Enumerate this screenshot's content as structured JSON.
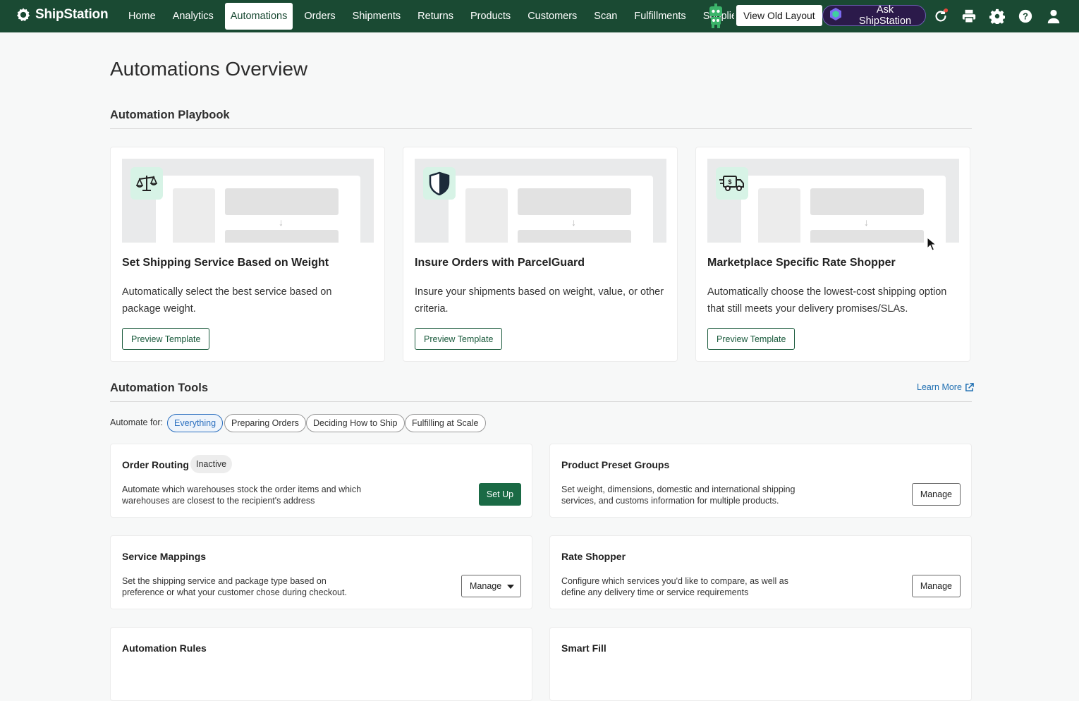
{
  "app": {
    "brand": "ShipStation",
    "accent": "#1a4a33"
  },
  "nav": {
    "items": [
      {
        "label": "Home",
        "active": false
      },
      {
        "label": "Analytics",
        "active": false
      },
      {
        "label": "Automations",
        "active": true
      },
      {
        "label": "Orders",
        "active": false
      },
      {
        "label": "Shipments",
        "active": false
      },
      {
        "label": "Returns",
        "active": false
      },
      {
        "label": "Products",
        "active": false
      },
      {
        "label": "Customers",
        "active": false
      },
      {
        "label": "Scan",
        "active": false
      },
      {
        "label": "Fulfillments",
        "active": false
      },
      {
        "label": "Supplies",
        "active": false
      }
    ],
    "view_old_layout": "View Old Layout",
    "ask_label": "Ask ShipStation",
    "icons": [
      "refresh-icon",
      "printer-icon",
      "gear-icon",
      "help-icon",
      "user-icon"
    ]
  },
  "page": {
    "title": "Automations Overview"
  },
  "playbook": {
    "title": "Automation Playbook",
    "cards": [
      {
        "icon": "scale-icon",
        "title": "Set Shipping Service Based on Weight",
        "desc": "Automatically select the best service based on package weight.",
        "button": "Preview Template"
      },
      {
        "icon": "shield-icon",
        "title": "Insure Orders with ParcelGuard",
        "desc": "Insure your shipments based on weight, value, or other criteria.",
        "button": "Preview Template"
      },
      {
        "icon": "delivery-truck-icon",
        "title": "Marketplace Specific Rate Shopper",
        "desc": "Automatically choose the lowest-cost shipping option that still meets your delivery promises/SLAs.",
        "button": "Preview Template"
      }
    ]
  },
  "tools": {
    "title": "Automation Tools",
    "learn_more": "Learn More",
    "filter_label": "Automate for:",
    "filters": [
      {
        "label": "Everything",
        "active": true
      },
      {
        "label": "Preparing Orders",
        "active": false
      },
      {
        "label": "Deciding How to Ship",
        "active": false
      },
      {
        "label": "Fulfilling at Scale",
        "active": false
      }
    ],
    "cards": [
      {
        "name": "Order Routing",
        "status": "Inactive",
        "desc": "Automate which warehouses stock the order items and which warehouses are closest to the recipient's address",
        "button": "Set Up"
      },
      {
        "name": "Product Preset Groups",
        "desc": "Set weight, dimensions, domestic and international shipping services, and customs information for multiple products.",
        "button": "Manage"
      },
      {
        "name": "Service Mappings",
        "desc": "Set the shipping service and package type based on preference or what your customer chose during checkout.",
        "button": "Manage"
      },
      {
        "name": "Rate Shopper",
        "desc": "Configure which services you'd like to compare, as well as define any delivery time or service requirements",
        "button": "Manage"
      },
      {
        "name": "Automation Rules"
      },
      {
        "name": "Smart Fill"
      }
    ]
  }
}
